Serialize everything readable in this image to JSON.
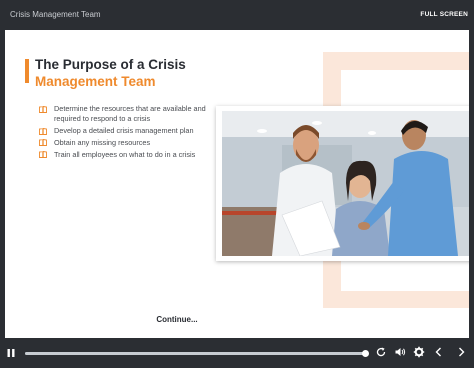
{
  "window": {
    "title": "Crisis Management Team",
    "fullscreen_label": "FULL SCREEN"
  },
  "slide": {
    "heading_line1": "The Purpose of a Crisis",
    "heading_line2": "Management Team",
    "bullets": [
      "Determine the resources that are available and required to respond to a crisis",
      "Develop a detailed crisis management plan",
      "Obtain any missing resources",
      "Train all employees on what to do in a crisis"
    ],
    "bullet_icon": "book-icon",
    "photo_alt": "photo-of-three-coworkers",
    "continue_label": "Continue..."
  },
  "controls": {
    "icons": [
      "pause-icon",
      "replay-icon",
      "volume-icon",
      "settings-icon",
      "previous-icon",
      "next-icon"
    ],
    "progress": 0.99
  },
  "colors": {
    "accent": "#ef8a2d",
    "chrome": "#2b2e33",
    "text": "#2a2d33"
  }
}
